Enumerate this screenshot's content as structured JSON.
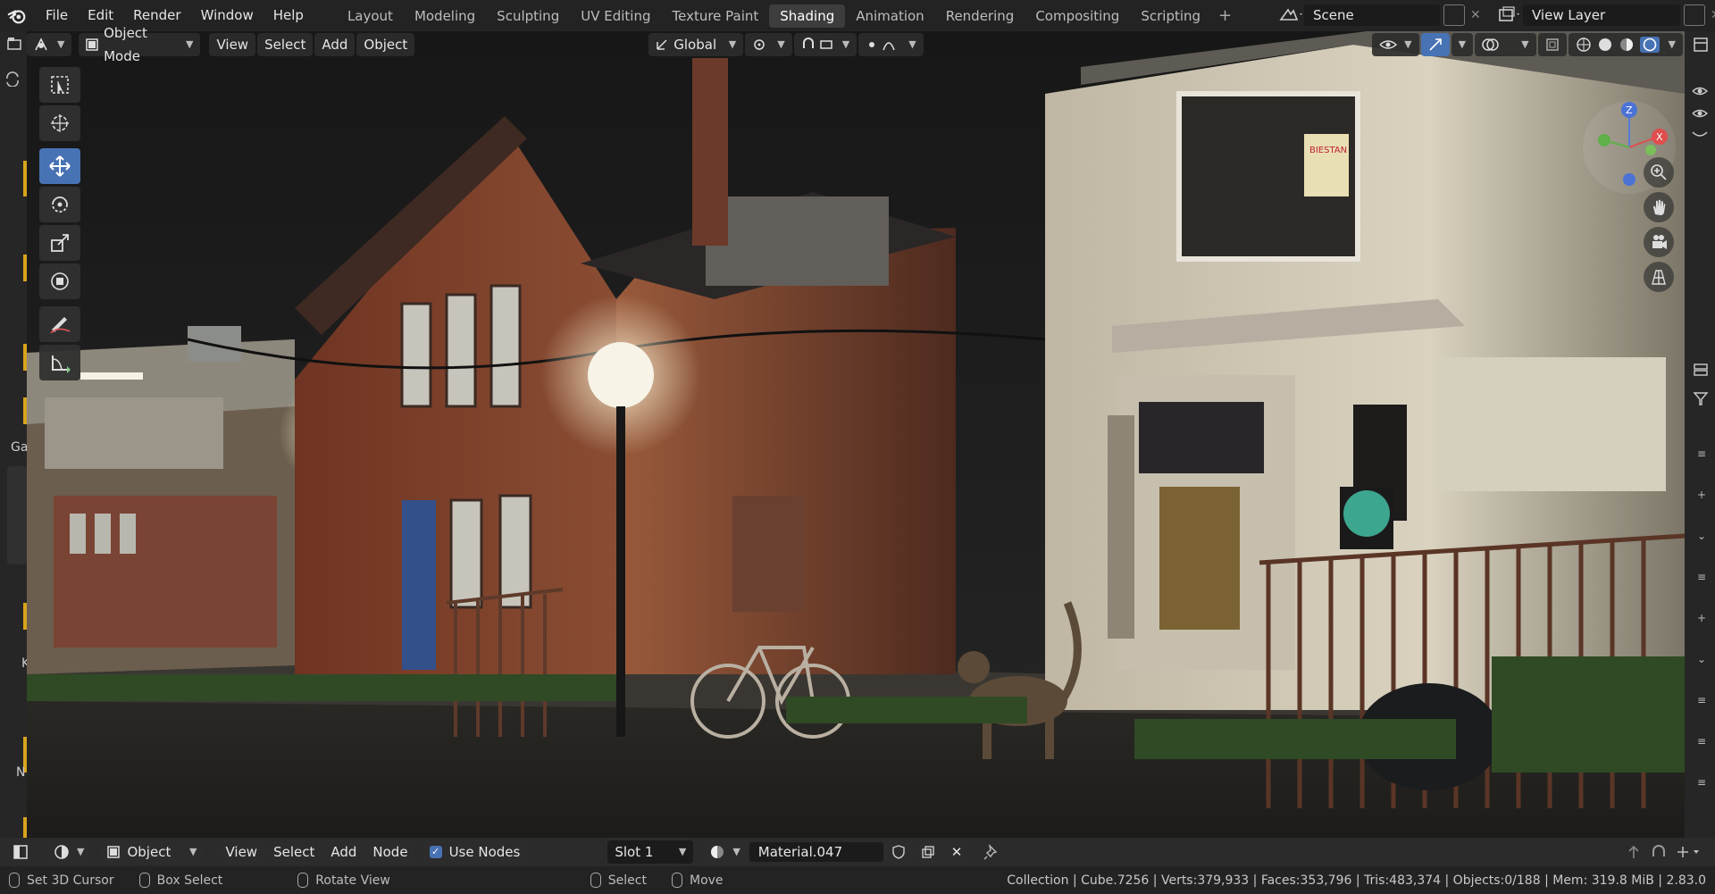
{
  "top_menu": [
    "File",
    "Edit",
    "Render",
    "Window",
    "Help"
  ],
  "workspaces": [
    "Layout",
    "Modeling",
    "Sculpting",
    "UV Editing",
    "Texture Paint",
    "Shading",
    "Animation",
    "Rendering",
    "Compositing",
    "Scripting"
  ],
  "active_workspace": "Shading",
  "scene_name": "Scene",
  "view_layer": "View Layer",
  "viewport_header": {
    "mode": "Object Mode",
    "menus": [
      "View",
      "Select",
      "Add",
      "Object"
    ],
    "transform_orientation": "Global"
  },
  "side_labels": {
    "ga": "Ga",
    "k": "K",
    "n": "N"
  },
  "gizmo": {
    "x": "X",
    "z": "Z"
  },
  "scene_signs": {
    "sign_text": "BIESTAN"
  },
  "shader_header": {
    "editor_type": "Object",
    "menus": [
      "View",
      "Select",
      "Add",
      "Node"
    ],
    "use_nodes_label": "Use Nodes",
    "slot": "Slot 1",
    "material": "Material.047"
  },
  "status_bar": {
    "items": [
      "Set 3D Cursor",
      "Box Select",
      "Rotate View",
      "Select",
      "Move"
    ],
    "stats": "Collection | Cube.7256 | Verts:379,933 | Faces:353,796 | Tris:483,374 | Objects:0/188 | Mem: 319.8 MiB | 2.83.0"
  },
  "colors": {
    "accent": "#4772b3",
    "active_tab": "#3d3d3d",
    "panel": "#232323"
  }
}
